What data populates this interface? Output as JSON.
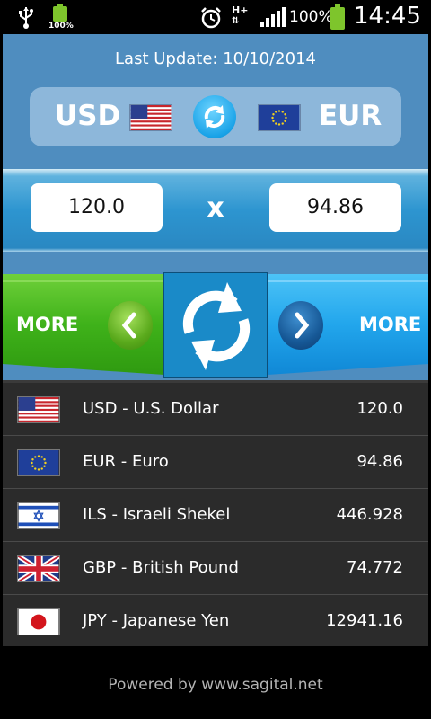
{
  "status_bar": {
    "small_battery_pct": "100%",
    "network": "H+",
    "battery_pct": "100%",
    "time": "14:45"
  },
  "header": {
    "last_update": "Last Update: 10/10/2014",
    "from_code": "USD",
    "to_code": "EUR"
  },
  "converter": {
    "from_amount": "120.0",
    "times_symbol": "x",
    "to_amount": "94.86"
  },
  "more_left_label": "MORE",
  "more_right_label": "MORE",
  "currencies": [
    {
      "name": "USD - U.S. Dollar",
      "value": "120.0",
      "flag": "us-flag-icon"
    },
    {
      "name": "EUR - Euro",
      "value": "94.86",
      "flag": "eu-flag-icon"
    },
    {
      "name": "ILS - Israeli Shekel",
      "value": "446.928",
      "flag": "il-flag-icon"
    },
    {
      "name": "GBP - British Pound",
      "value": "74.772",
      "flag": "gb-flag-icon"
    },
    {
      "name": "JPY - Japanese Yen",
      "value": "12941.16",
      "flag": "jp-flag-icon"
    }
  ],
  "footer": "Powered by www.sagital.net",
  "colors": {
    "header_blue": "#4f8dbf",
    "accent_blue": "#1a8ac8",
    "green": "#7ec52c",
    "list_bg": "#2b2b2b"
  }
}
